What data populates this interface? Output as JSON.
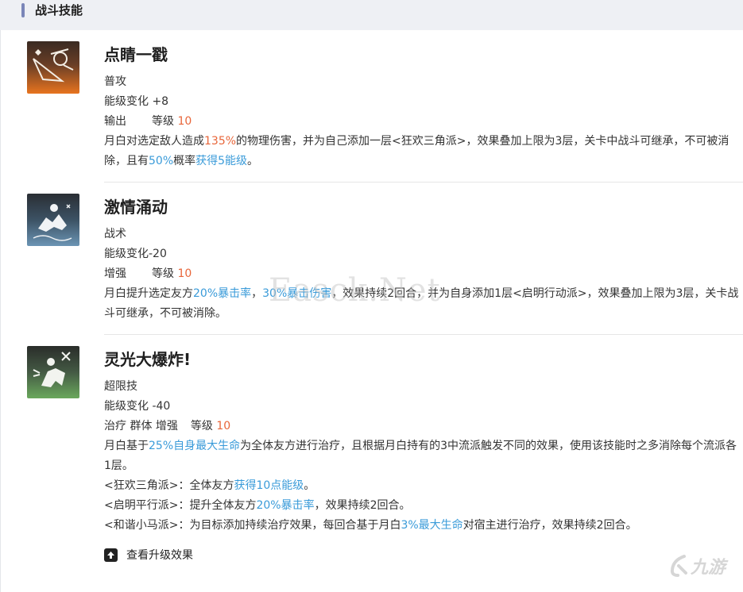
{
  "section": {
    "title": "战斗技能"
  },
  "skills": [
    {
      "name": "点睛一戳",
      "icon": "skill-icon-dianjing",
      "type": "普攻",
      "energy": "能级变化 +8",
      "tags": "输出",
      "level_label": "等级",
      "level": "10",
      "desc": [
        {
          "t": "月白对选定敌人造成"
        },
        {
          "t": "135%",
          "c": "orange"
        },
        {
          "t": "的物理伤害，并为自己添加一层<狂欢三角派>，效果叠加上限为3层，关卡中战斗可继承，不可被消除，且有"
        },
        {
          "t": "50%",
          "c": "blue"
        },
        {
          "t": "概率"
        },
        {
          "t": "获得5能级",
          "c": "blue"
        },
        {
          "t": "。"
        }
      ]
    },
    {
      "name": "激情涌动",
      "icon": "skill-icon-jiqing",
      "type": "战术",
      "energy": "能级变化-20",
      "tags": "增强",
      "level_label": "等级",
      "level": "10",
      "desc": [
        {
          "t": "月白提升选定友方"
        },
        {
          "t": "20%暴击率",
          "c": "blue"
        },
        {
          "t": "，"
        },
        {
          "t": "30%暴击伤害",
          "c": "blue"
        },
        {
          "t": "，效果持续2回合，并为自身添加1层<启明行动派>，效果叠加上限为3层，关卡战斗可继承，不可被消除。"
        }
      ]
    },
    {
      "name": "灵光大爆炸!",
      "icon": "skill-icon-lingguang",
      "type": "超限技",
      "energy": "能级变化 -40",
      "tags": "治疗 群体 增强",
      "level_label": "等级",
      "level": "10",
      "desc": [
        {
          "t": "月白基于"
        },
        {
          "t": "25%自身最大生命",
          "c": "blue"
        },
        {
          "t": "为全体友方进行治疗，且根据月白持有的3中流派触发不同的效果，使用该技能时之多消除每个流派各1层。"
        }
      ],
      "effects": [
        [
          {
            "t": "<狂欢三角派>：全体友方"
          },
          {
            "t": "获得10点能级",
            "c": "blue"
          },
          {
            "t": "。"
          }
        ],
        [
          {
            "t": "<启明平行派>：提升全体友方"
          },
          {
            "t": "20%暴击率",
            "c": "blue"
          },
          {
            "t": "，效果持续2回合。"
          }
        ],
        [
          {
            "t": "<和谐小马派>：为目标添加持续治疗效果，每回合基于月白"
          },
          {
            "t": "3%最大生命",
            "c": "blue"
          },
          {
            "t": "对宿主进行治疗，效果持续2回合。"
          }
        ]
      ]
    }
  ],
  "upgrade": {
    "label": "查看升级效果",
    "icon": "arrow-up-icon"
  },
  "watermark": "Easck.Net",
  "logo": {
    "text": "九游",
    "icon": "jiuyou-logo-icon"
  },
  "colors": {
    "orange": "#e8663a",
    "blue": "#3a9bd9",
    "header_bg": "#eef0f4",
    "accent_bar": "#7a86b8"
  }
}
